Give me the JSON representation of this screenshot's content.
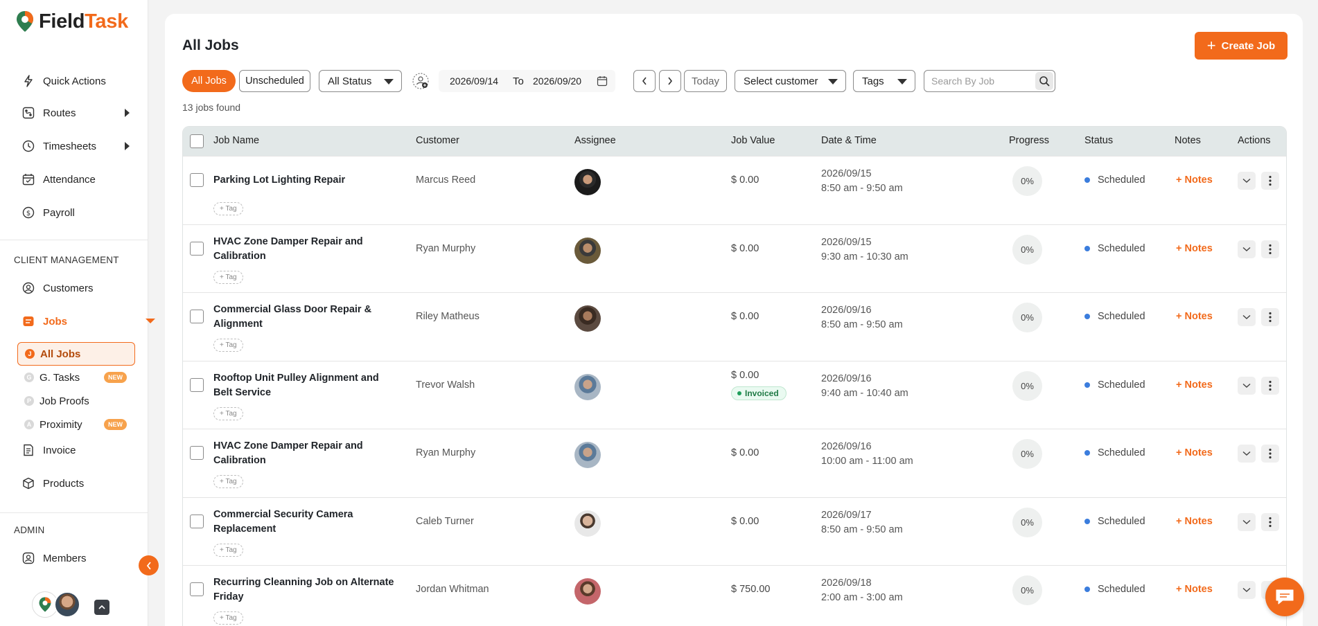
{
  "app": {
    "name_part1": "Field",
    "name_part2": "Task"
  },
  "sidebar": {
    "quick_actions": "Quick Actions",
    "routes": "Routes",
    "timesheets": "Timesheets",
    "attendance": "Attendance",
    "payroll": "Payroll",
    "client_management_label": "CLIENT MANAGEMENT",
    "customers": "Customers",
    "jobs": "Jobs",
    "jobs_sub": [
      {
        "label": "All Jobs",
        "letter": "J",
        "badge": ""
      },
      {
        "label": "G. Tasks",
        "letter": "G",
        "badge": "NEW"
      },
      {
        "label": "Job Proofs",
        "letter": "P",
        "badge": ""
      },
      {
        "label": "Proximity",
        "letter": "A",
        "badge": "NEW"
      }
    ],
    "invoice": "Invoice",
    "products": "Products",
    "admin_label": "ADMIN",
    "members": "Members"
  },
  "header": {
    "title": "All Jobs",
    "create_button": "Create Job"
  },
  "filters": {
    "all_jobs": "All Jobs",
    "unscheduled": "Unscheduled",
    "status": "All Status",
    "date_from": "2026/09/14",
    "to_label": "To",
    "date_to": "2026/09/20",
    "today": "Today",
    "customer": "Select customer",
    "tags": "Tags",
    "search_placeholder": "Search By Job"
  },
  "jobs_count": "13 jobs found",
  "table": {
    "columns": [
      "Job Name",
      "Customer",
      "Assignee",
      "Job Value",
      "Date & Time",
      "Progress",
      "Status",
      "Notes",
      "Actions"
    ],
    "tag_label": "+ Tag",
    "notes_label": "+ Notes",
    "rows": [
      {
        "name": "Parking Lot Lighting Repair",
        "customer": "Marcus Reed",
        "value": "$ 0.00",
        "invoiced": "",
        "date": "2026/09/15",
        "time": "8:50 am - 9:50 am",
        "progress": "0%",
        "status": "Scheduled"
      },
      {
        "name": "HVAC Zone Damper Repair and Calibration",
        "customer": "Ryan Murphy",
        "value": "$ 0.00",
        "invoiced": "",
        "date": "2026/09/15",
        "time": "9:30 am - 10:30 am",
        "progress": "0%",
        "status": "Scheduled"
      },
      {
        "name": "Commercial Glass Door Repair & Alignment",
        "customer": "Riley Matheus",
        "value": "$ 0.00",
        "invoiced": "",
        "date": "2026/09/16",
        "time": "8:50 am - 9:50 am",
        "progress": "0%",
        "status": "Scheduled"
      },
      {
        "name": "Rooftop Unit Pulley Alignment and Belt Service",
        "customer": "Trevor Walsh",
        "value": "$ 0.00",
        "invoiced": "Invoiced",
        "date": "2026/09/16",
        "time": "9:40 am - 10:40 am",
        "progress": "0%",
        "status": "Scheduled"
      },
      {
        "name": "HVAC Zone Damper Repair and Calibration",
        "customer": "Ryan Murphy",
        "value": "$ 0.00",
        "invoiced": "",
        "date": "2026/09/16",
        "time": "10:00 am - 11:00 am",
        "progress": "0%",
        "status": "Scheduled"
      },
      {
        "name": "Commercial Security Camera Replacement",
        "customer": "Caleb Turner",
        "value": "$ 0.00",
        "invoiced": "",
        "date": "2026/09/17",
        "time": "8:50 am - 9:50 am",
        "progress": "0%",
        "status": "Scheduled"
      },
      {
        "name": "Recurring Cleanning Job on Alternate Friday",
        "customer": "Jordan Whitman",
        "value": "$ 750.00",
        "invoiced": "",
        "date": "2026/09/18",
        "time": "2:00 am - 3:00 am",
        "progress": "0%",
        "status": "Scheduled"
      }
    ]
  },
  "colors": {
    "accent": "#f26a1b",
    "status_scheduled": "#3b7ddd",
    "header_bg": "#e2e8e8"
  }
}
